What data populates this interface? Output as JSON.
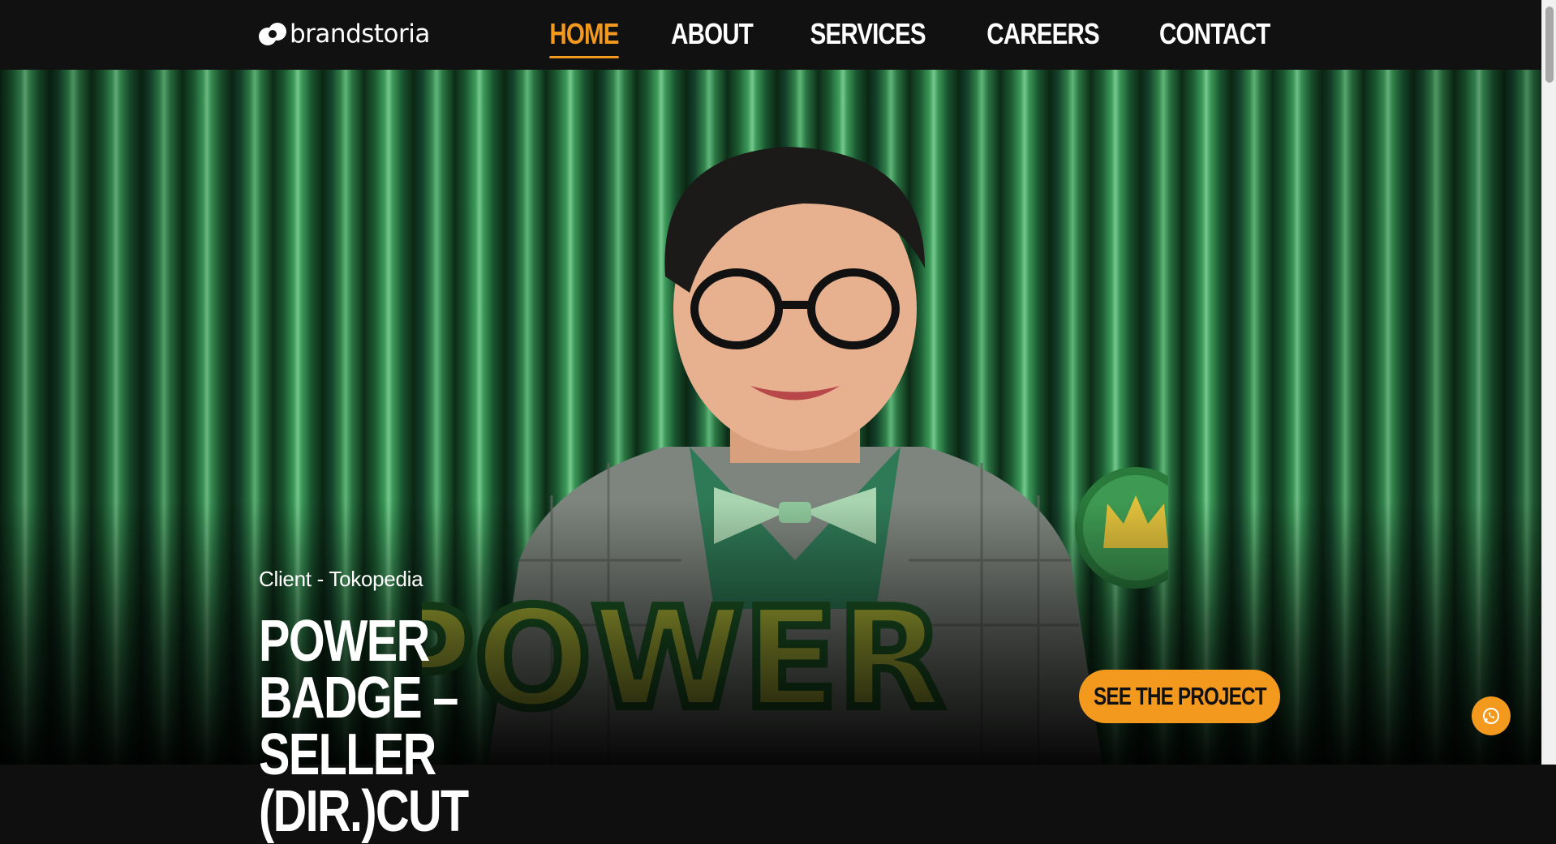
{
  "brand": {
    "name": "brandstoria",
    "logo_icon": "brandstoria-logo-icon"
  },
  "nav": {
    "items": [
      {
        "label": "HOME",
        "active": true
      },
      {
        "label": "ABOUT",
        "active": false
      },
      {
        "label": "SERVICES",
        "active": false
      },
      {
        "label": "CAREERS",
        "active": false
      },
      {
        "label": "CONTACT",
        "active": false
      }
    ]
  },
  "hero": {
    "client": "Client - Tokopedia",
    "title": "POWER BADGE – SELLER (DIR.)CUT",
    "cta_label": "SEE THE PROJECT",
    "floating_button_icon": "whatsapp-icon"
  },
  "colors": {
    "accent": "#f39a1e",
    "navbar_bg": "#111111",
    "text": "#ffffff",
    "curtain_green": "#2f8049"
  }
}
